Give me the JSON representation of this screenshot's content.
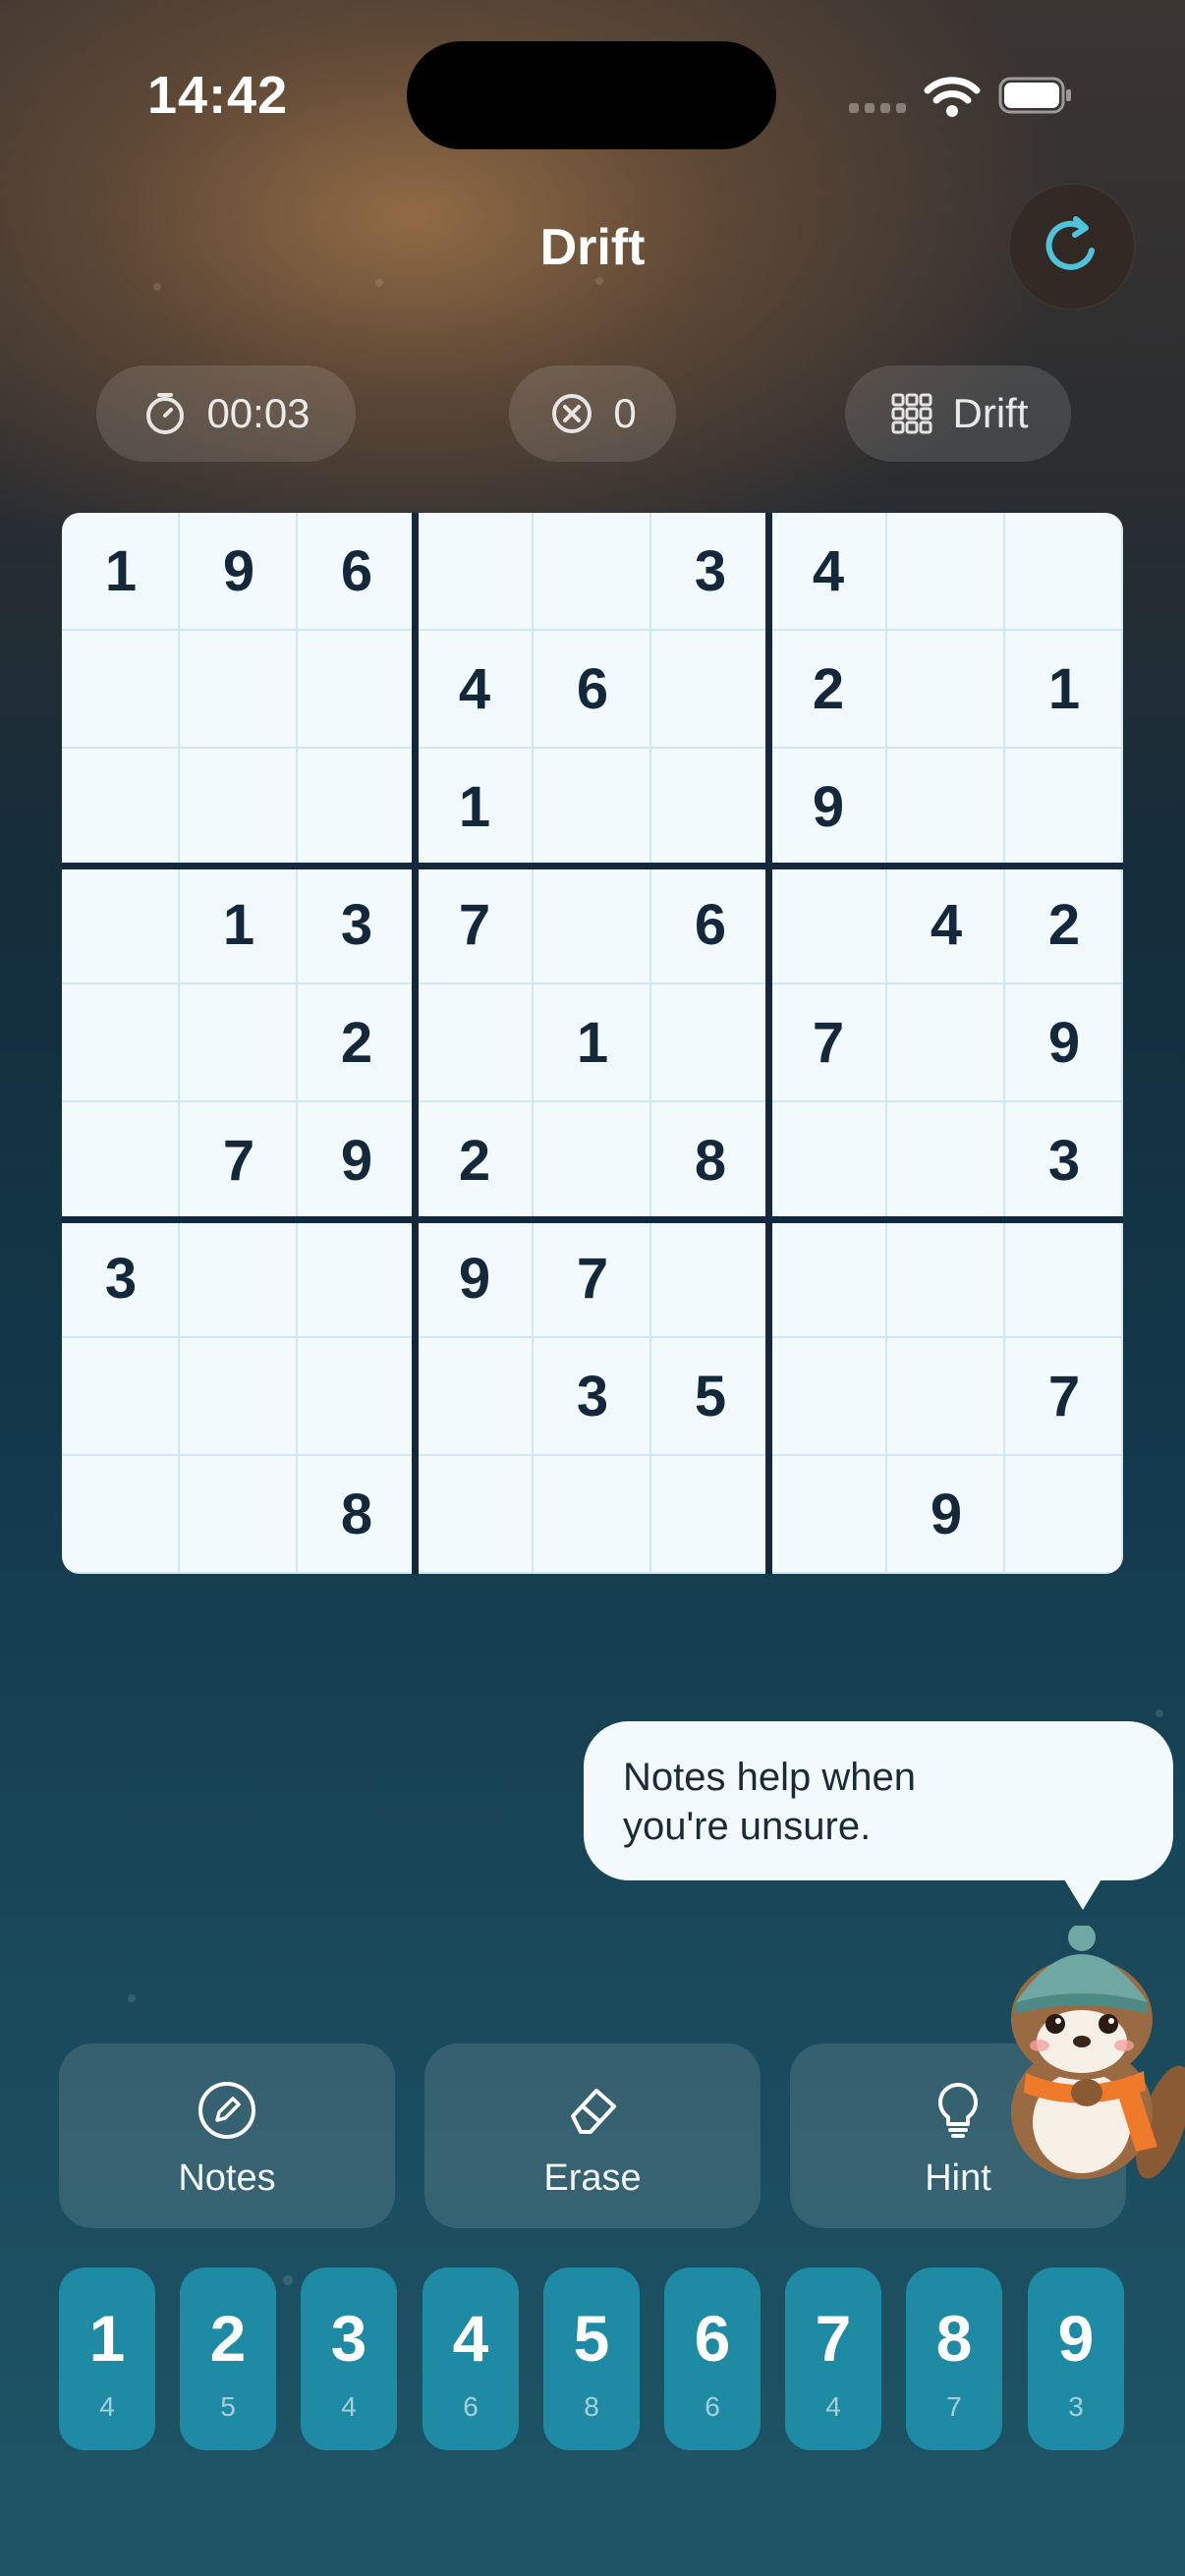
{
  "status_bar": {
    "time": "14:42"
  },
  "header": {
    "title": "Drift",
    "refresh_icon": "refresh-icon"
  },
  "stats": {
    "timer": "00:03",
    "mistakes": "0",
    "mode": "Drift"
  },
  "board": {
    "rows": [
      [
        "1",
        "9",
        "6",
        "",
        "",
        "3",
        "4",
        "",
        ""
      ],
      [
        "",
        "",
        "",
        "4",
        "6",
        "",
        "2",
        "",
        "1"
      ],
      [
        "",
        "",
        "",
        "1",
        "",
        "",
        "9",
        "",
        ""
      ],
      [
        "",
        "1",
        "3",
        "7",
        "",
        "6",
        "",
        "4",
        "2"
      ],
      [
        "",
        "",
        "2",
        "",
        "1",
        "",
        "7",
        "",
        "9"
      ],
      [
        "",
        "7",
        "9",
        "2",
        "",
        "8",
        "",
        "",
        "3"
      ],
      [
        "3",
        "",
        "",
        "9",
        "7",
        "",
        "",
        "",
        ""
      ],
      [
        "",
        "",
        "",
        "",
        "3",
        "5",
        "",
        "",
        "7"
      ],
      [
        "",
        "",
        "8",
        "",
        "",
        "",
        "",
        "9",
        ""
      ]
    ]
  },
  "hint_bubble": {
    "line1": "Notes help when",
    "line2": "you're unsure."
  },
  "tools": {
    "notes_label": "Notes",
    "erase_label": "Erase",
    "hint_label": "Hint"
  },
  "numpad": [
    {
      "digit": "1",
      "remaining": "4"
    },
    {
      "digit": "2",
      "remaining": "5"
    },
    {
      "digit": "3",
      "remaining": "4"
    },
    {
      "digit": "4",
      "remaining": "6"
    },
    {
      "digit": "5",
      "remaining": "8"
    },
    {
      "digit": "6",
      "remaining": "6"
    },
    {
      "digit": "7",
      "remaining": "4"
    },
    {
      "digit": "8",
      "remaining": "7"
    },
    {
      "digit": "9",
      "remaining": "3"
    }
  ],
  "colors": {
    "accent": "#4fc3dc",
    "board_bg": "#f2fafd",
    "grid_line": "#13283a",
    "numpad_key": "#1f8aa3"
  }
}
